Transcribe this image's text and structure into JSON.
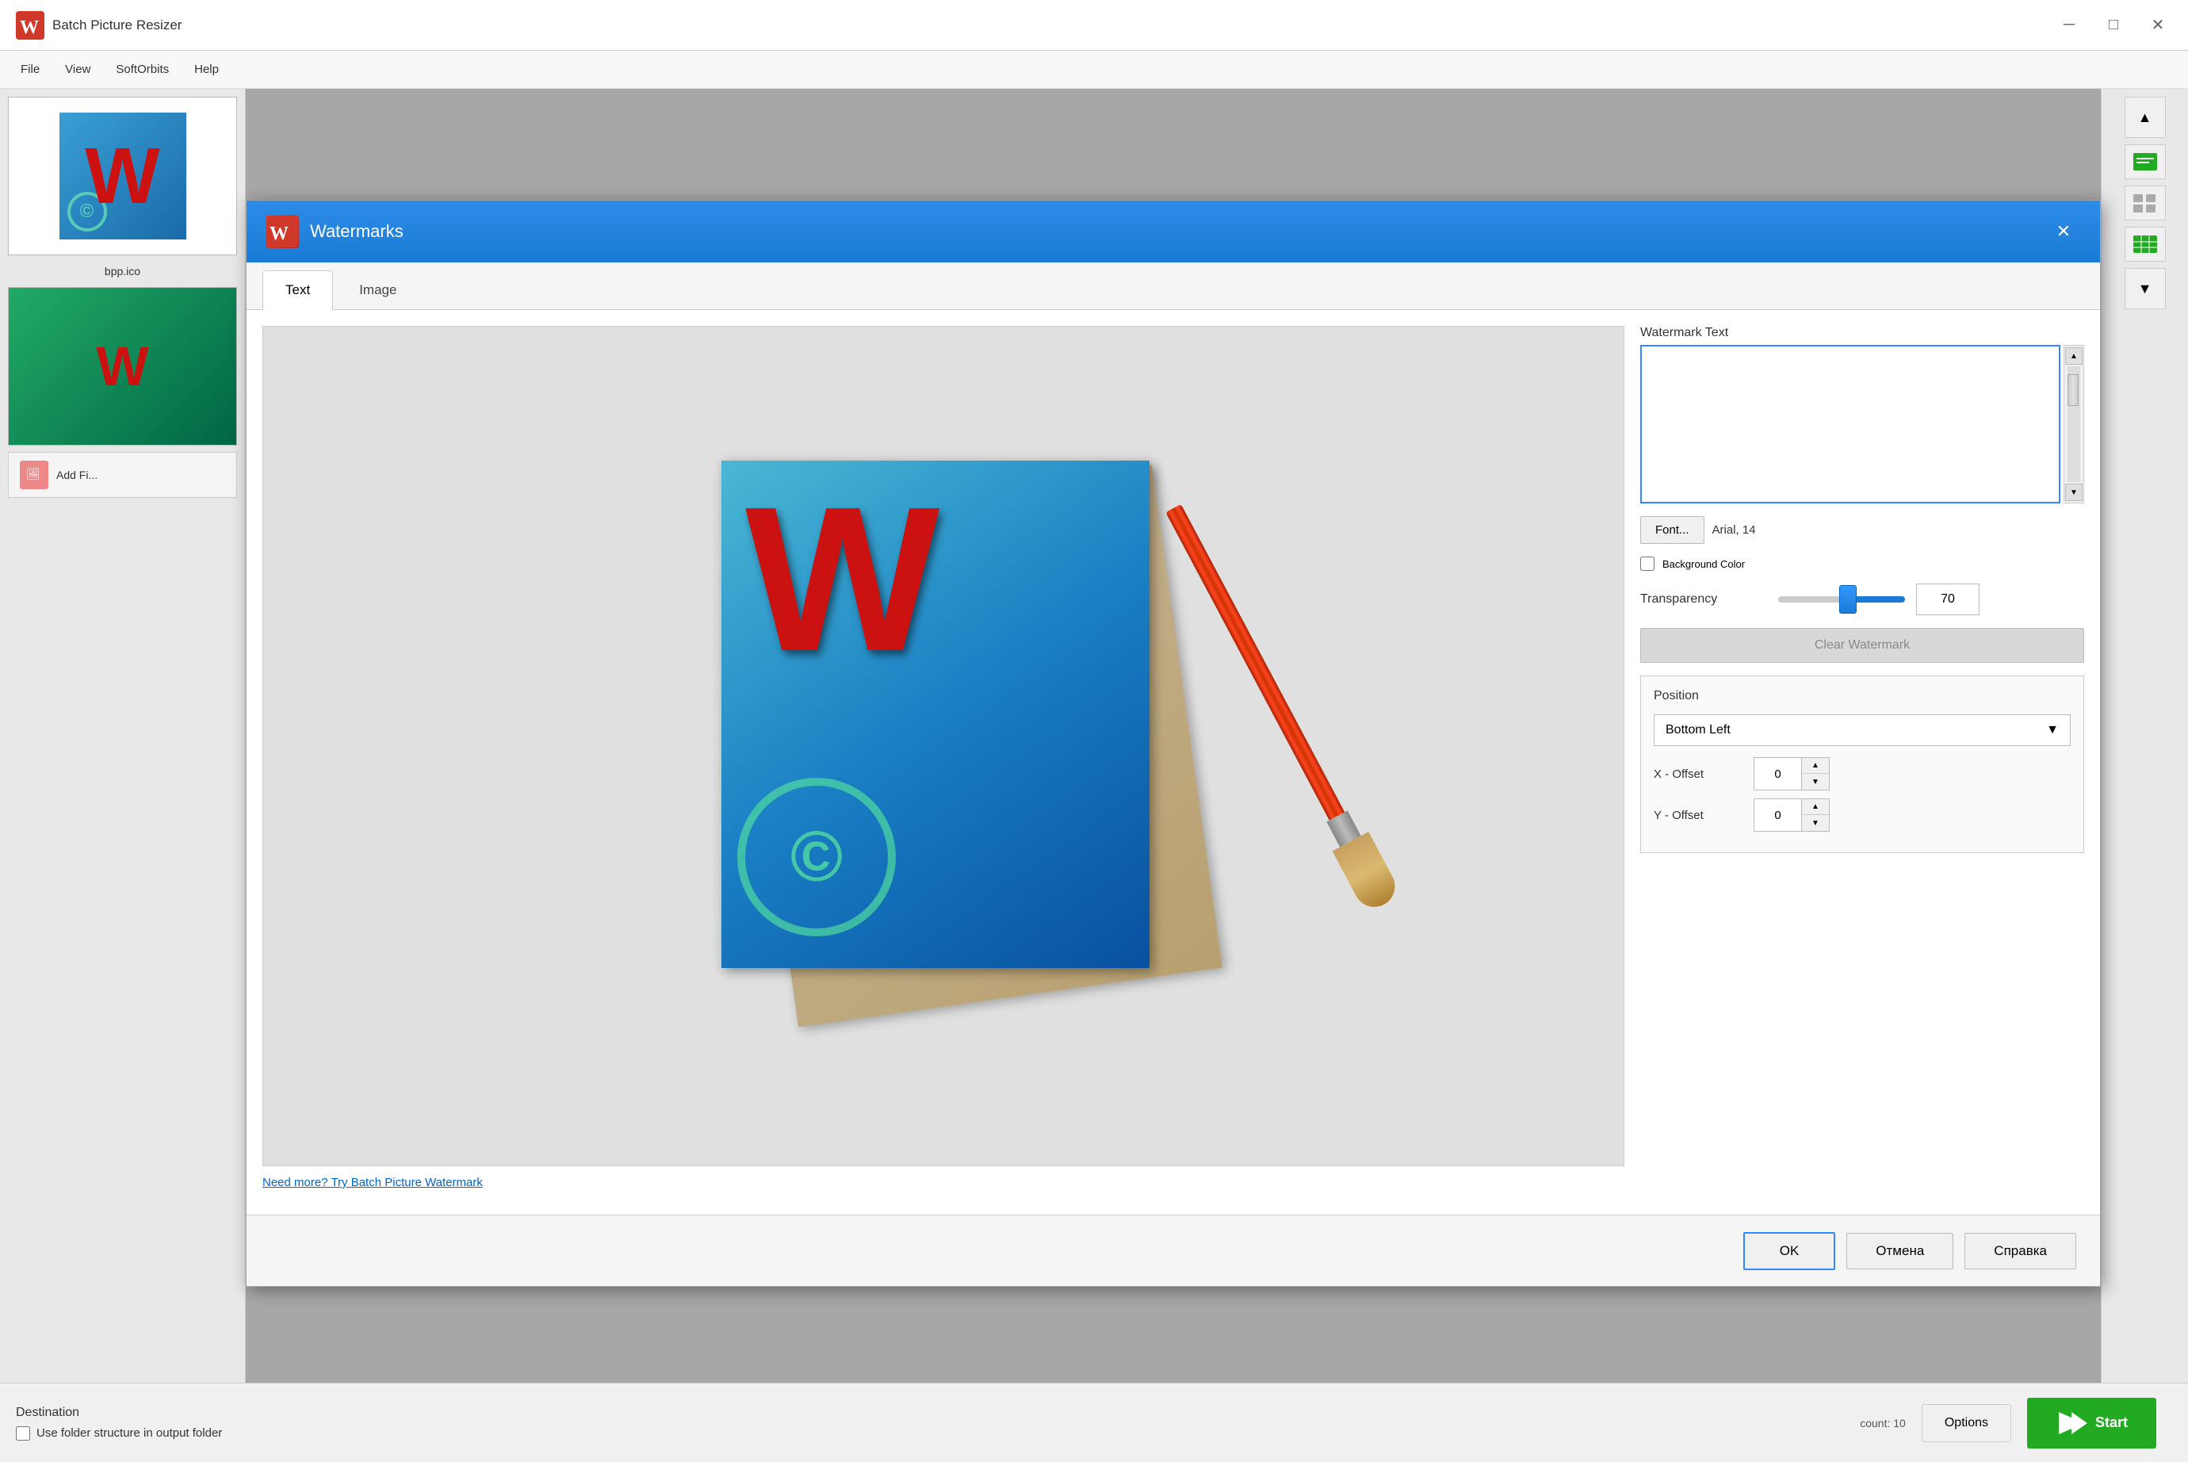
{
  "app": {
    "title": "Batch Picture Resizer",
    "icon_text": "W"
  },
  "title_bar": {
    "minimize_label": "─",
    "maximize_label": "□",
    "close_label": "✕"
  },
  "menu": {
    "items": [
      "File",
      "View",
      "SoftOrbits",
      "Help"
    ]
  },
  "sidebar": {
    "item1": {
      "label": "bpp.ico",
      "letter": "W"
    },
    "add_files": "Add Fi..."
  },
  "right_panel": {
    "scroll_up": "▲",
    "scroll_down": "▼"
  },
  "bottom_bar": {
    "destination_label": "Destination",
    "use_folder_label": "Use folder structure in output folder",
    "options_label": "Options",
    "start_label": "Start",
    "count_label": "count: 10"
  },
  "modal": {
    "title": "Watermarks",
    "icon_text": "W",
    "close_btn": "✕",
    "tabs": [
      {
        "label": "Text",
        "active": true
      },
      {
        "label": "Image",
        "active": false
      }
    ],
    "watermark_text_section": {
      "label": "Watermark Text",
      "placeholder": "",
      "current_value": ""
    },
    "font_btn": "Font...",
    "font_value": "Arial, 14",
    "bg_color_label": "Background Color",
    "transparency_label": "Transparency",
    "transparency_value": "70",
    "clear_btn": "Clear Watermark",
    "position": {
      "label": "Position",
      "current": "Bottom Left",
      "x_offset_label": "X - Offset",
      "x_offset_value": "0",
      "y_offset_label": "Y - Offset",
      "y_offset_value": "0"
    },
    "footer": {
      "ok": "OK",
      "cancel": "Отмена",
      "help": "Справка"
    },
    "preview_link": "Need more? Try Batch Picture Watermark"
  }
}
